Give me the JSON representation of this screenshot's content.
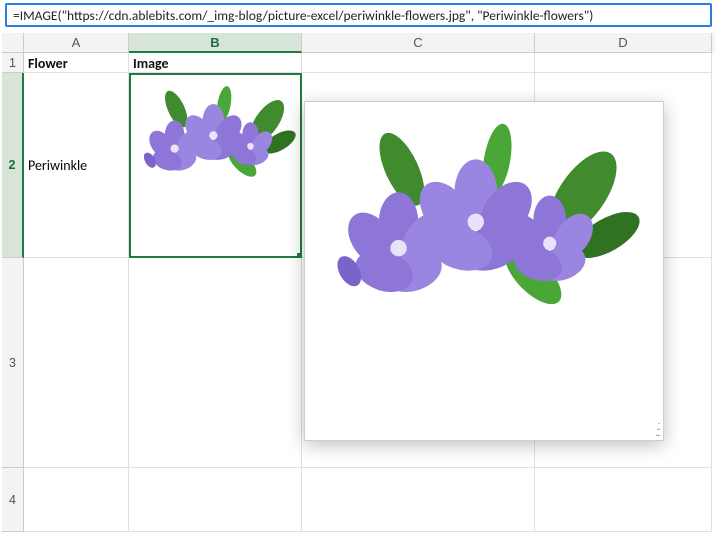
{
  "formula_bar": {
    "value": "=IMAGE(\"https://cdn.ablebits.com/_img-blog/picture-excel/periwinkle-flowers.jpg\", \"Periwinkle-flowers\")"
  },
  "columns": {
    "A": "A",
    "B": "B",
    "C": "C",
    "D": "D"
  },
  "row_labels": {
    "r1": "1",
    "r2": "2",
    "r3": "3",
    "r4": "4"
  },
  "header": {
    "flower": "Flower",
    "image": "Image"
  },
  "data": {
    "flower_name": "Periwinkle"
  },
  "selection": {
    "cell": "B2"
  }
}
